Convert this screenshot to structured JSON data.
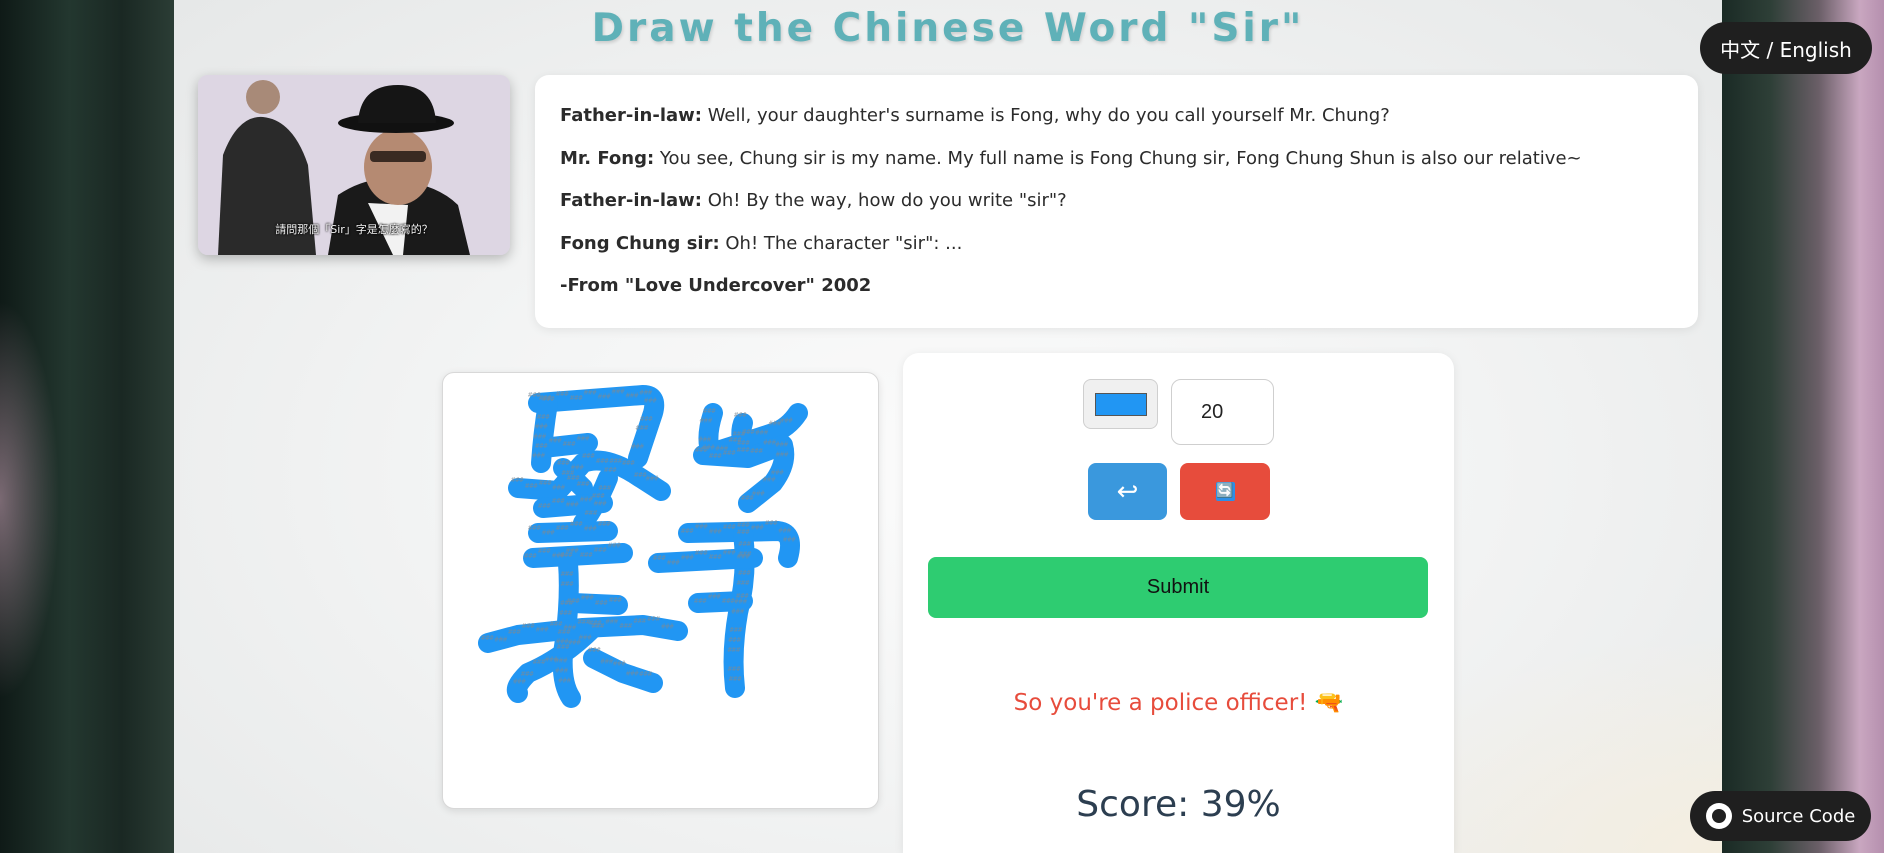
{
  "page": {
    "title": "Draw the Chinese Word \"Sir\""
  },
  "language_toggle": {
    "label": "中文 / English"
  },
  "movie_still": {
    "subtitle": "請問那個「Sir」字是怎麼寫的？"
  },
  "dialogue": {
    "lines": [
      {
        "speaker": "Father-in-law:",
        "text": " Well, your daughter's surname is Fong, why do you call yourself Mr. Chung?"
      },
      {
        "speaker": "Mr. Fong:",
        "text": " You see, Chung sir is my name. My full name is Fong Chung sir, Fong Chung Shun is also our relative~"
      },
      {
        "speaker": "Father-in-law:",
        "text": " Oh! By the way, how do you write \"sir\"?"
      },
      {
        "speaker": "Fong Chung sir:",
        "text": " Oh! The character \"sir\": ..."
      }
    ],
    "source": "-From \"Love Undercover\" 2002"
  },
  "canvas": {
    "stroke_color": "#2196f3",
    "template_glyph": "###"
  },
  "controls": {
    "brush_color": "#2196f3",
    "brush_size": "20",
    "undo_icon": "undo-arrow",
    "undo_glyph": "↩",
    "clear_icon": "refresh-icon",
    "clear_glyph": "🔄",
    "submit_label": "Submit"
  },
  "result": {
    "message": "So you're a police officer! 🔫",
    "score_label": "Score:",
    "score_value": "39%"
  },
  "source_link": {
    "label": "Source Code",
    "icon": "github-icon"
  },
  "colors": {
    "title": "#5fb1b8",
    "submit": "#2ecc71",
    "undo": "#3a98dd",
    "clear": "#e74c3c",
    "message": "#e74c3c",
    "score": "#2c3e50"
  }
}
